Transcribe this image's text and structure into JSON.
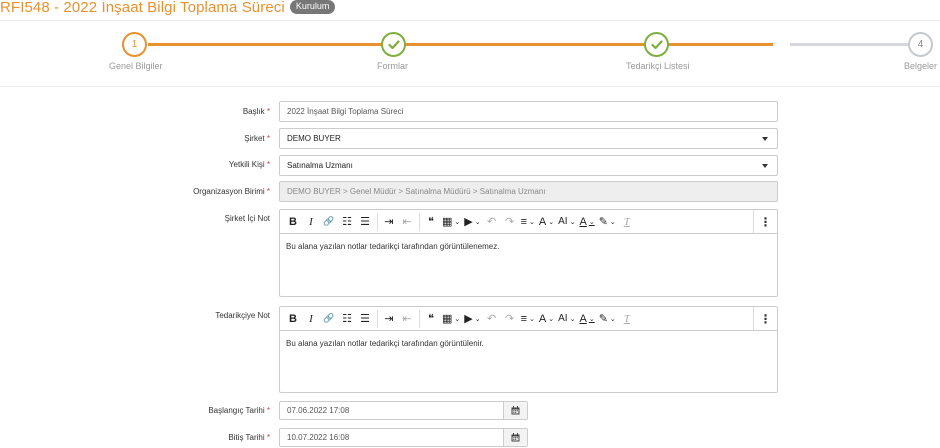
{
  "header": {
    "title": "RFI548 - 2022 İnşaat Bilgi Toplama Süreci",
    "badge": "Kurulum"
  },
  "steps": [
    {
      "number": "1",
      "label": "Genel Bilgiler",
      "state": "active"
    },
    {
      "number": "",
      "label": "Formlar",
      "state": "done"
    },
    {
      "number": "",
      "label": "Tedarikçi Listesi",
      "state": "done"
    },
    {
      "number": "4",
      "label": "Belgeler",
      "state": "todo"
    }
  ],
  "colors": {
    "accent": "#e8912f",
    "done": "#7fae3f",
    "pending": "#c6c9cf",
    "required": "#d9363e"
  },
  "form": {
    "baslik": {
      "label": "Başlık",
      "value": "2022 İnşaat Bilgi Toplama Süreci"
    },
    "sirket": {
      "label": "Şirket",
      "value": "DEMO BUYER"
    },
    "yetkili": {
      "label": "Yetkili Kişi",
      "value": "Satınalma Uzmanı"
    },
    "org": {
      "label": "Organizasyon Birimi",
      "value": "DEMO BUYER > Genel Müdür > Satınalma Müdürü > Satınalma Uzmanı"
    },
    "sirket_ici_not": {
      "label": "Şirket İçi Not",
      "text": "Bu alana yazılan notlar tedarikçi tarafından görüntülenemez."
    },
    "tedarikciye_not": {
      "label": "Tedarikçiye Not",
      "text": "Bu alana yazılan notlar tedarikçi tarafından görüntülenir."
    },
    "baslangic": {
      "label": "Başlangıç Tarihi",
      "value": "07.06.2022 17:08"
    },
    "bitis": {
      "label": "Bitiş Tarihi",
      "value": "10.07.2022 16:08"
    },
    "required_mark": "*"
  },
  "toolbar": {
    "bold": "B",
    "italic": "I",
    "link": "🔗",
    "bullet_list": "☷",
    "numbered_list": "☰",
    "indent": "⇥",
    "outdent": "⇤",
    "blockquote": "❝",
    "table": "▦",
    "media": "▶",
    "undo": "↶",
    "redo": "↷",
    "align": "≡",
    "font_size": "A",
    "ai": "AI",
    "font_color": "A",
    "highlight": "✎",
    "clear_format": "T",
    "more": "⋮",
    "chevron": "⌄"
  },
  "icons": {
    "check": "check-icon",
    "calendar": "calendar-icon",
    "dropdown": "caret-down-icon"
  }
}
